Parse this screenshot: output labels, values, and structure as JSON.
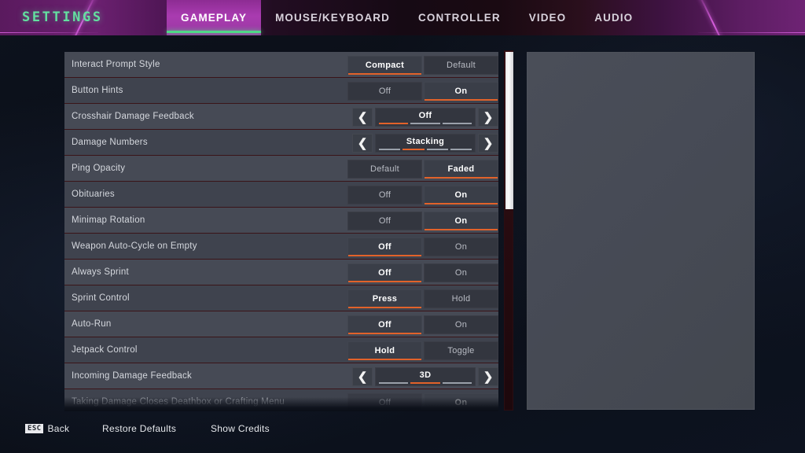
{
  "header": {
    "title": "SETTINGS",
    "tabs": [
      {
        "label": "GAMEPLAY",
        "active": true
      },
      {
        "label": "MOUSE/KEYBOARD",
        "active": false
      },
      {
        "label": "CONTROLLER",
        "active": false
      },
      {
        "label": "VIDEO",
        "active": false
      },
      {
        "label": "AUDIO",
        "active": false
      }
    ],
    "accent_green": "#4fd887",
    "accent_magenta": "#cd5ad4"
  },
  "settings": {
    "rows": [
      {
        "label": "Interact Prompt Style",
        "type": "toggle",
        "options": [
          "Compact",
          "Default"
        ],
        "selected": 0
      },
      {
        "label": "Button Hints",
        "type": "toggle",
        "options": [
          "Off",
          "On"
        ],
        "selected": 1
      },
      {
        "label": "Crosshair Damage Feedback",
        "type": "stepper",
        "value": "Off",
        "segments": 3,
        "segment_index": 0
      },
      {
        "label": "Damage Numbers",
        "type": "stepper",
        "value": "Stacking",
        "segments": 4,
        "segment_index": 1
      },
      {
        "label": "Ping Opacity",
        "type": "toggle",
        "options": [
          "Default",
          "Faded"
        ],
        "selected": 1
      },
      {
        "label": "Obituaries",
        "type": "toggle",
        "options": [
          "Off",
          "On"
        ],
        "selected": 1
      },
      {
        "label": "Minimap Rotation",
        "type": "toggle",
        "options": [
          "Off",
          "On"
        ],
        "selected": 1
      },
      {
        "label": "Weapon Auto-Cycle on Empty",
        "type": "toggle",
        "options": [
          "Off",
          "On"
        ],
        "selected": 0
      },
      {
        "label": "Always Sprint",
        "type": "toggle",
        "options": [
          "Off",
          "On"
        ],
        "selected": 0
      },
      {
        "label": "Sprint Control",
        "type": "toggle",
        "options": [
          "Press",
          "Hold"
        ],
        "selected": 0
      },
      {
        "label": "Auto-Run",
        "type": "toggle",
        "options": [
          "Off",
          "On"
        ],
        "selected": 0
      },
      {
        "label": "Jetpack Control",
        "type": "toggle",
        "options": [
          "Hold",
          "Toggle"
        ],
        "selected": 0
      },
      {
        "label": "Incoming Damage Feedback",
        "type": "stepper",
        "value": "3D",
        "segments": 3,
        "segment_index": 1
      },
      {
        "label": "Taking Damage Closes Deathbox or Crafting Menu",
        "type": "toggle",
        "options": [
          "Off",
          "On"
        ],
        "selected": 1,
        "clipped": true
      }
    ],
    "selected_underline_color": "#e2622a"
  },
  "scrollbar": {
    "thumb_top_pct": 0,
    "thumb_height_pct": 44
  },
  "footer": {
    "back_key": "ESC",
    "back_label": "Back",
    "restore_label": "Restore Defaults",
    "credits_label": "Show Credits"
  },
  "icons": {
    "left_arrow": "❮",
    "right_arrow": "❯"
  }
}
